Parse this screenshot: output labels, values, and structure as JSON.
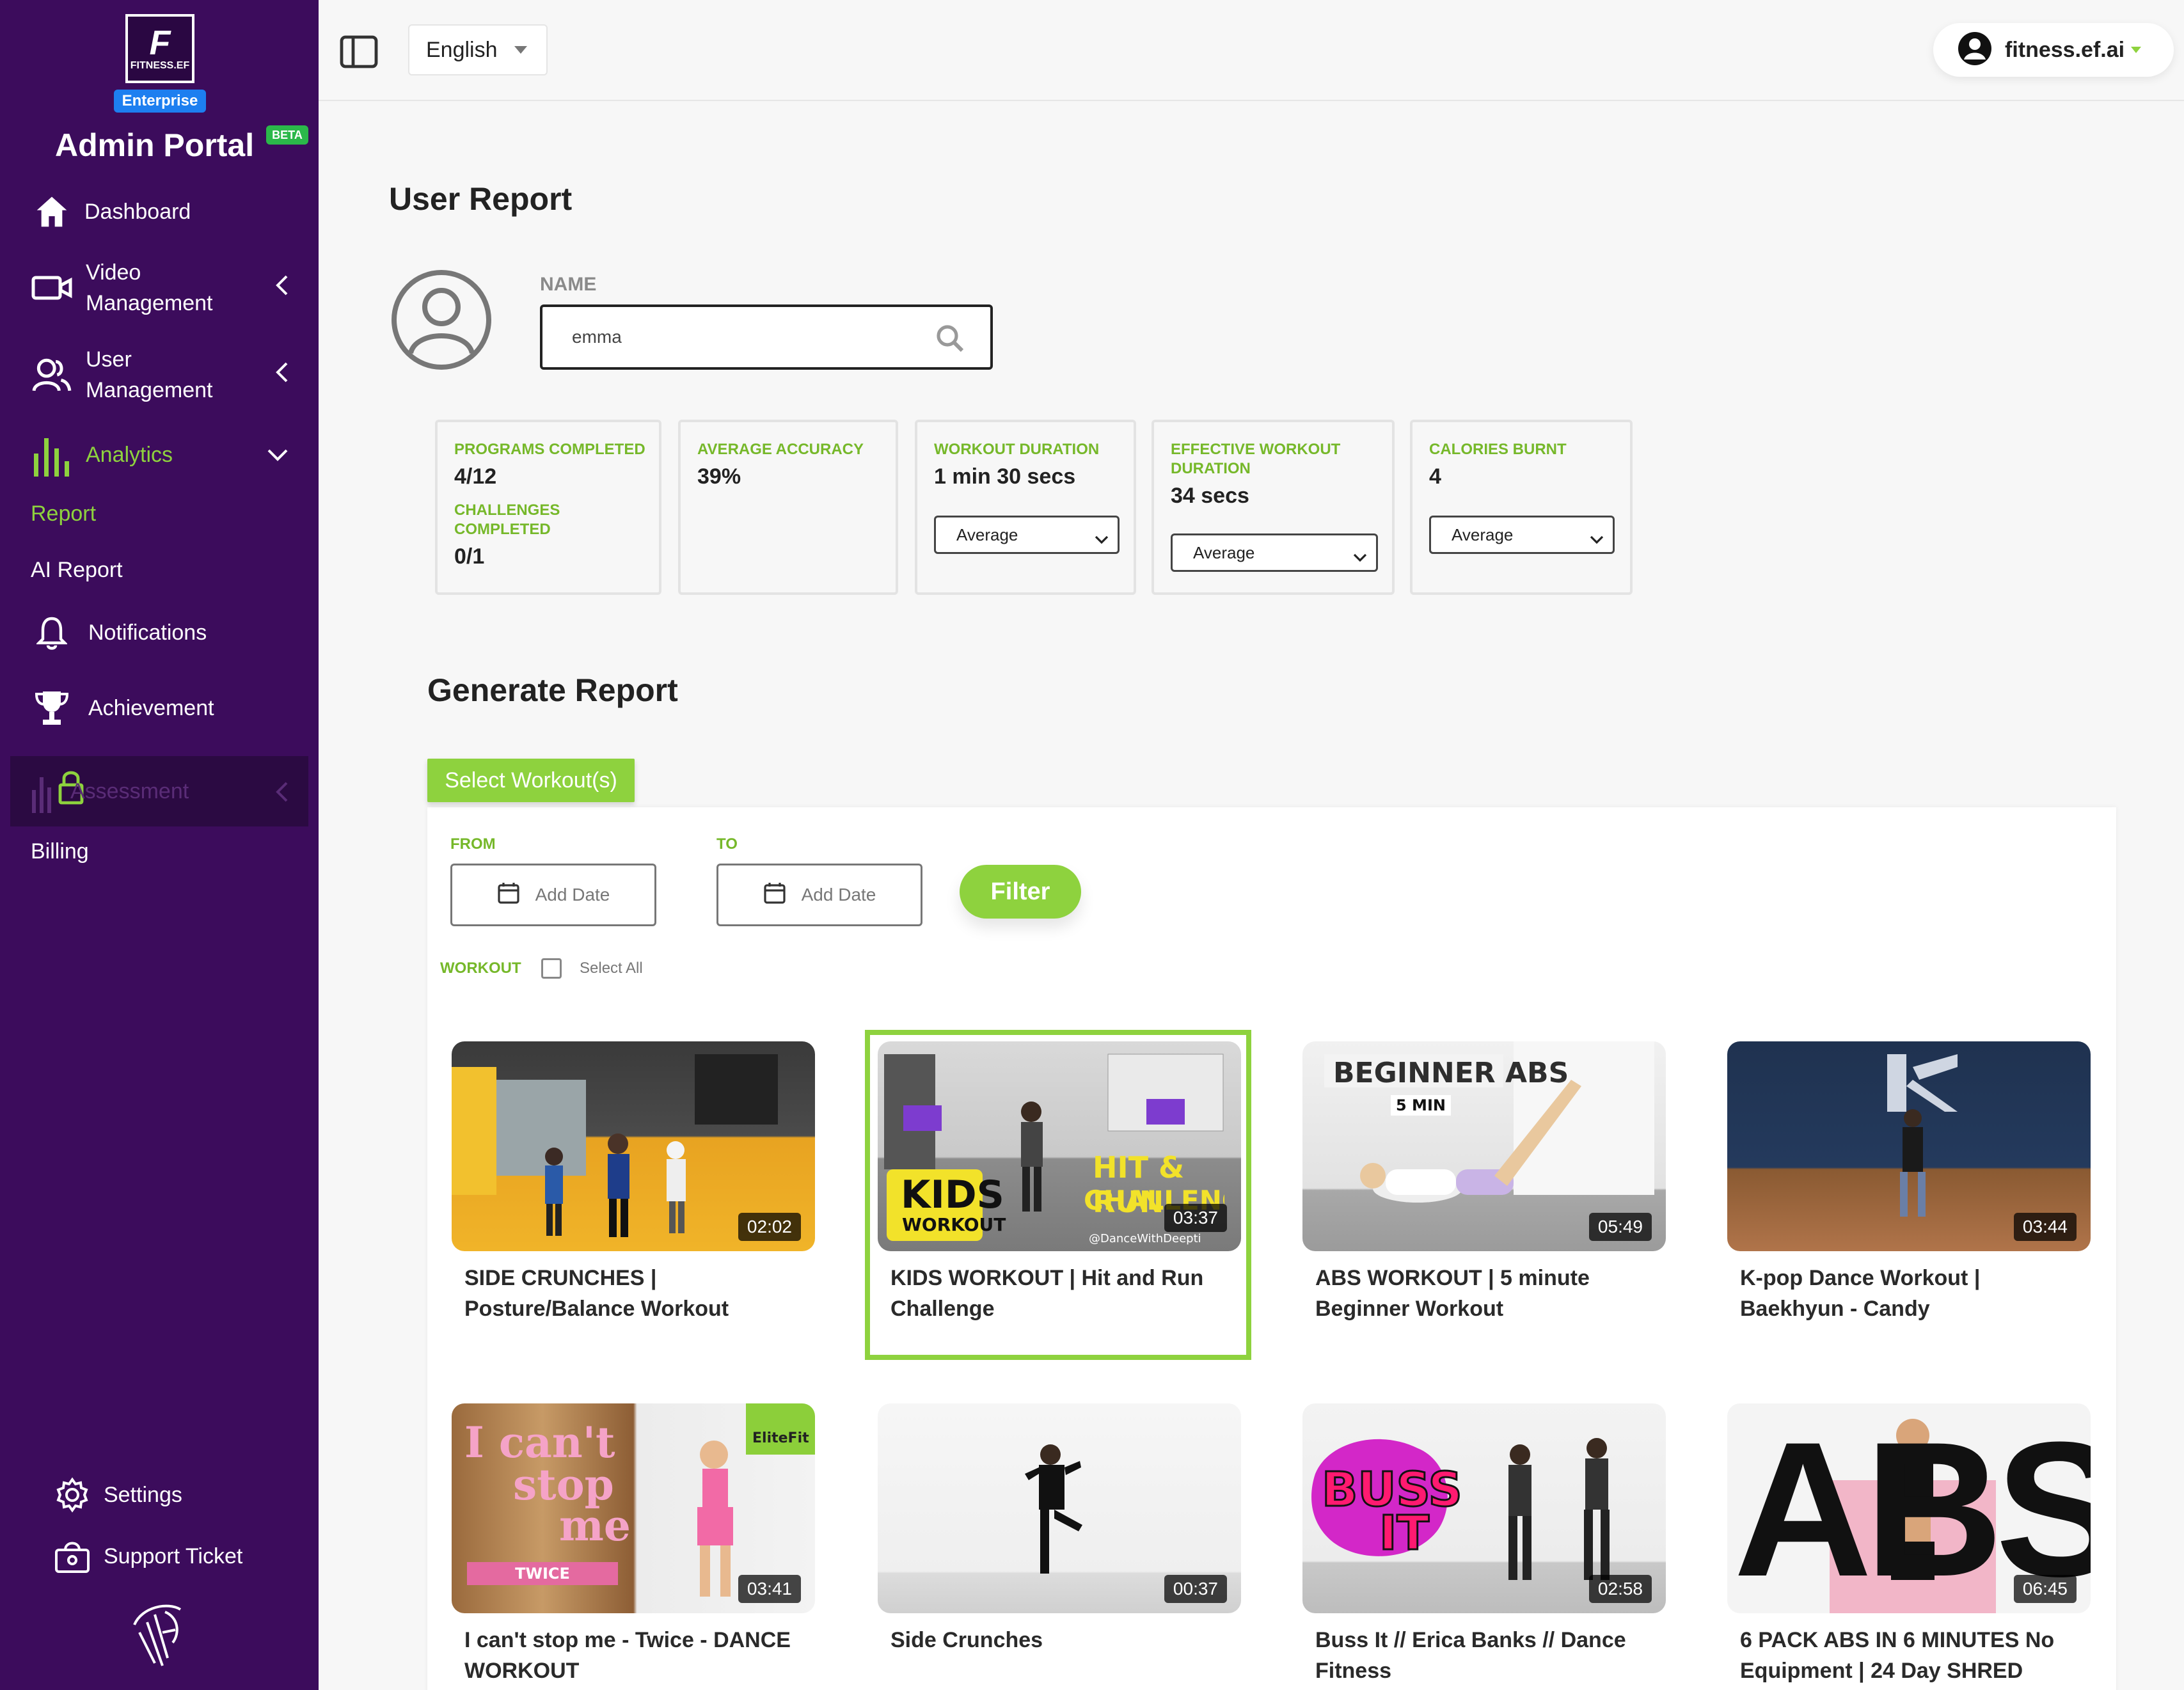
{
  "sidebar": {
    "logo_letter": "F",
    "logo_text": "FITNESS.EF",
    "badge": "Enterprise",
    "title": "Admin Portal",
    "beta": "BETA",
    "items": {
      "dashboard": "Dashboard",
      "video": [
        "Video",
        "Management"
      ],
      "user": [
        "User",
        "Management"
      ],
      "analytics": "Analytics",
      "report": "Report",
      "ai_report": "AI Report",
      "notifications": "Notifications",
      "achievement": "Achievement",
      "assessment": "Assessment",
      "billing": "Billing",
      "settings": "Settings",
      "support": "Support Ticket"
    },
    "accent_color": "#8ed23e",
    "bg_color": "#3c0c5c"
  },
  "topbar": {
    "language": "English",
    "account_name": "fitness.ef.ai"
  },
  "user_report": {
    "title": "User Report",
    "name_label": "NAME",
    "name_value": "emma"
  },
  "stats": {
    "programs_label": "PROGRAMS COMPLETED",
    "programs_value": "4/12",
    "challenges_label": "CHALLENGES COMPLETED",
    "challenges_value": "0/1",
    "accuracy_label": "AVERAGE ACCURACY",
    "accuracy_value": "39%",
    "duration_label": "WORKOUT DURATION",
    "duration_value": "1 min 30 secs",
    "duration_select": "Average",
    "effective_label_1": "EFFECTIVE WORKOUT",
    "effective_label_2": "DURATION",
    "effective_value": "34 secs",
    "effective_select": "Average",
    "calories_label": "CALORIES BURNT",
    "calories_value": "4",
    "calories_select": "Average"
  },
  "generate": {
    "title": "Generate Report",
    "select_button": "Select Workout(s)",
    "from_label": "FROM",
    "to_label": "TO",
    "date_placeholder": "Add Date",
    "filter_button": "Filter",
    "workout_label": "WORKOUT",
    "select_all": "Select All"
  },
  "workouts": [
    {
      "title": "SIDE CRUNCHES | Posture/Balance Workout",
      "duration": "02:02",
      "selected": false
    },
    {
      "title": "KIDS WORKOUT | Hit and Run Challenge",
      "duration": "03:37",
      "selected": true,
      "overlay": [
        "KIDS",
        "WORKOUT",
        "HIT & RUN",
        "CHALLENGE",
        "@DanceWithDeepti"
      ]
    },
    {
      "title": "ABS WORKOUT | 5 minute Beginner Workout",
      "duration": "05:49",
      "selected": false,
      "overlay": [
        "BEGINNER ABS",
        "5 MIN"
      ]
    },
    {
      "title": "K-pop Dance Workout | Baekhyun - Candy",
      "duration": "03:44",
      "selected": false
    },
    {
      "title": "I can't stop me - Twice - DANCE WORKOUT",
      "duration": "03:41",
      "selected": false,
      "overlay": [
        "I can't",
        "stop",
        "me",
        "TWICE",
        "EliteFit"
      ]
    },
    {
      "title": "Side Crunches",
      "duration": "00:37",
      "selected": false
    },
    {
      "title": "Buss It // Erica Banks // Dance Fitness",
      "duration": "02:58",
      "selected": false,
      "overlay": [
        "BUSS",
        "IT"
      ]
    },
    {
      "title": "6 PACK ABS IN 6 MINUTES No Equipment | 24 Day SHRED",
      "duration": "06:45",
      "selected": false,
      "overlay": [
        "ABS"
      ]
    }
  ]
}
